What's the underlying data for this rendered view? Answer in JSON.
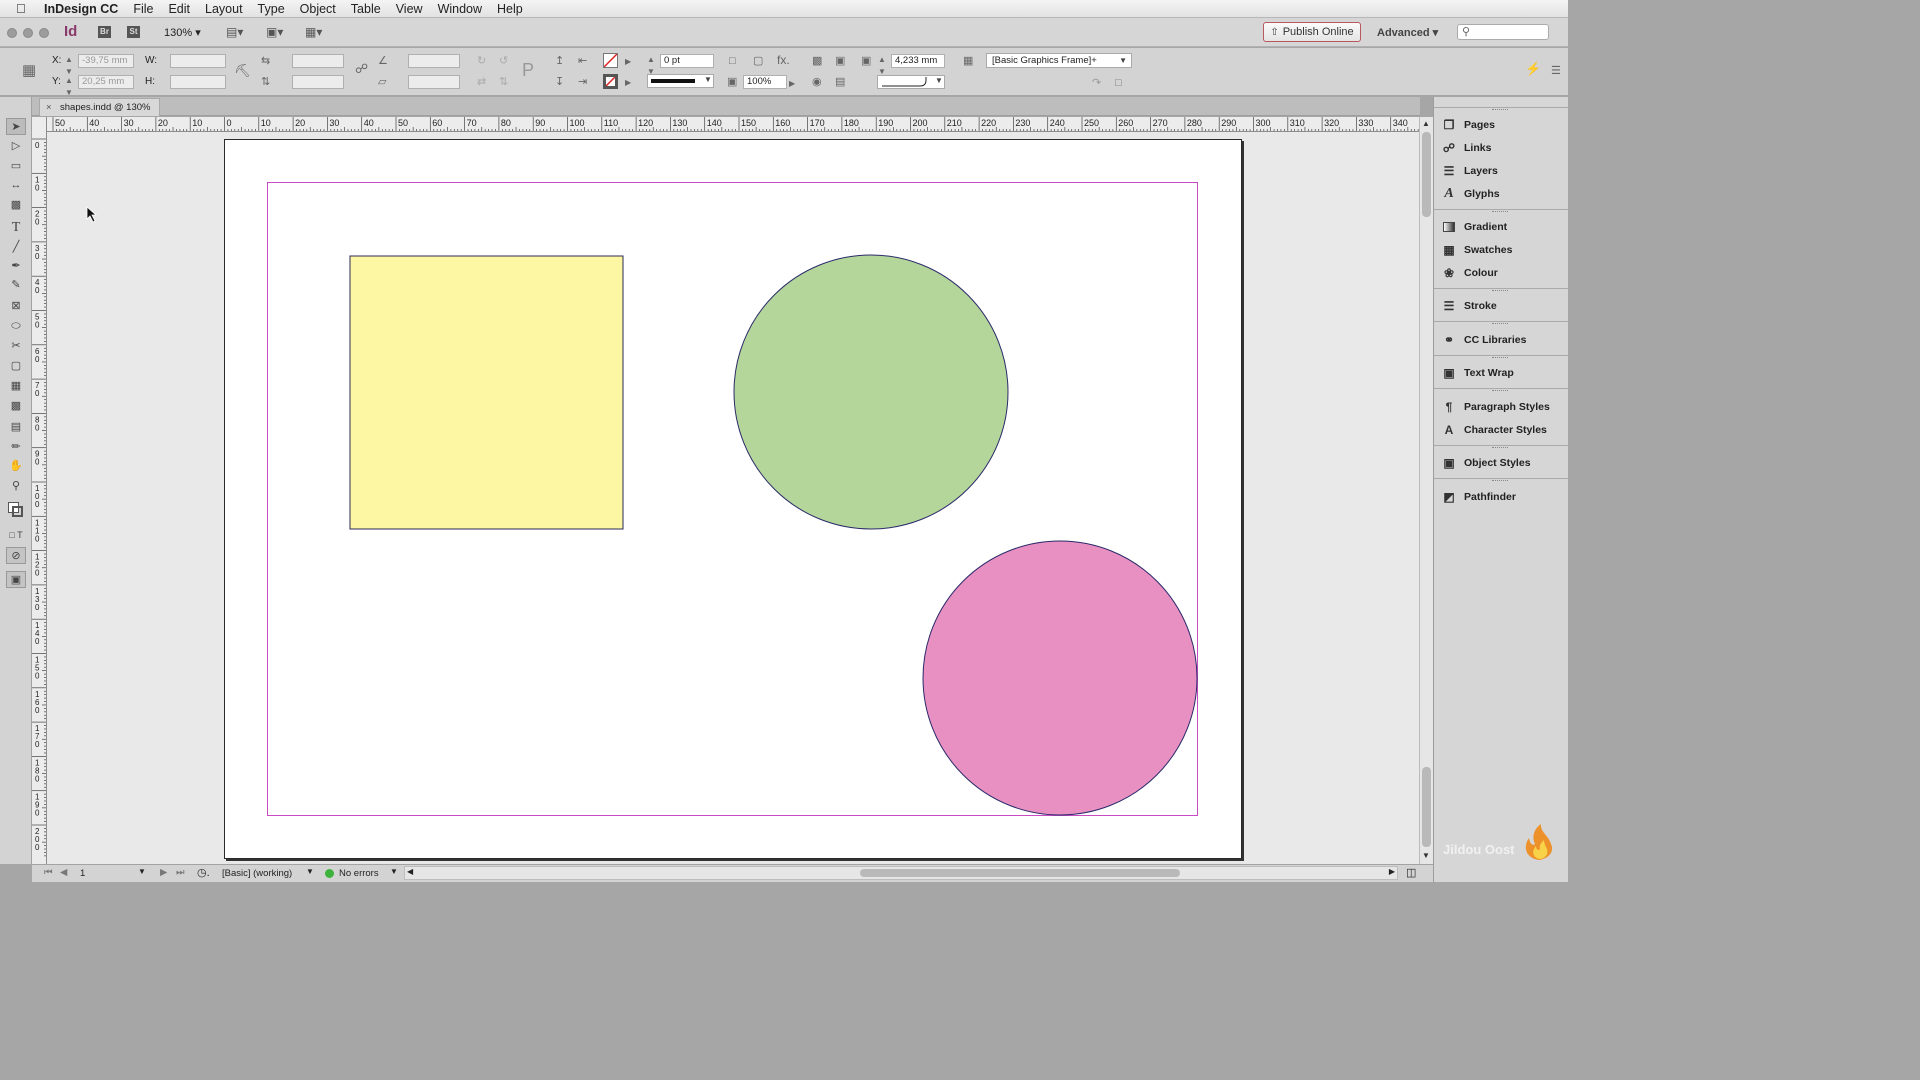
{
  "menubar": {
    "app_name": "InDesign CC",
    "items": [
      "File",
      "Edit",
      "Layout",
      "Type",
      "Object",
      "Table",
      "View",
      "Window",
      "Help"
    ]
  },
  "appbar": {
    "logo": "Id",
    "bridge": "Br",
    "stock": "St",
    "zoom": "130%",
    "publish_label": "Publish Online",
    "workspace": "Advanced"
  },
  "control": {
    "x_label": "X:",
    "x_value": "-39,75 mm",
    "y_label": "Y:",
    "y_value": "20,25 mm",
    "w_label": "W:",
    "h_label": "H:",
    "stroke_weight": "0 pt",
    "opacity": "100%",
    "corner_size": "4,233 mm",
    "object_style": "[Basic Graphics Frame]+"
  },
  "document": {
    "tab_title": "shapes.indd @ 130%"
  },
  "rulers": {
    "h_labels": [
      "50",
      "40",
      "30",
      "20",
      "10",
      "0",
      "10",
      "20",
      "30",
      "40",
      "50",
      "60",
      "70",
      "80",
      "90",
      "100",
      "110",
      "120",
      "130",
      "140",
      "150",
      "160",
      "170",
      "180",
      "190",
      "200",
      "210",
      "220",
      "230",
      "240",
      "250",
      "260",
      "270",
      "280",
      "290",
      "300",
      "310",
      "320",
      "330",
      "340"
    ],
    "v_labels": [
      "0",
      "10",
      "20",
      "30",
      "40",
      "50",
      "60",
      "70",
      "80",
      "90",
      "100",
      "110",
      "120",
      "130",
      "140",
      "150",
      "160",
      "170",
      "180",
      "190",
      "200"
    ]
  },
  "shapes": [
    {
      "type": "rectangle",
      "fill": "#fdf6a3",
      "stroke": "#2a2a55"
    },
    {
      "type": "ellipse",
      "fill": "#b4d69b",
      "stroke": "#2a2a6a"
    },
    {
      "type": "ellipse",
      "fill": "#e890c2",
      "stroke": "#2a2a6a"
    }
  ],
  "colors": {
    "margin_guide": "#c84bc4"
  },
  "status": {
    "page_number": "1",
    "preflight_profile": "[Basic] (working)",
    "errors_label": "No errors"
  },
  "panels": [
    {
      "label": "Pages",
      "icon": "pages-icon"
    },
    {
      "label": "Links",
      "icon": "links-icon"
    },
    {
      "label": "Layers",
      "icon": "layers-icon"
    },
    {
      "label": "Glyphs",
      "icon": "glyphs-icon"
    },
    {
      "label": "Gradient",
      "icon": "gradient-icon"
    },
    {
      "label": "Swatches",
      "icon": "swatches-icon"
    },
    {
      "label": "Colour",
      "icon": "colour-icon"
    },
    {
      "label": "Stroke",
      "icon": "stroke-icon"
    },
    {
      "label": "CC Libraries",
      "icon": "cc-libraries-icon"
    },
    {
      "label": "Text Wrap",
      "icon": "text-wrap-icon"
    },
    {
      "label": "Paragraph Styles",
      "icon": "paragraph-styles-icon"
    },
    {
      "label": "Character Styles",
      "icon": "character-styles-icon"
    },
    {
      "label": "Object Styles",
      "icon": "object-styles-icon"
    },
    {
      "label": "Pathfinder",
      "icon": "pathfinder-icon"
    }
  ],
  "watermark": "Jildou Oost"
}
